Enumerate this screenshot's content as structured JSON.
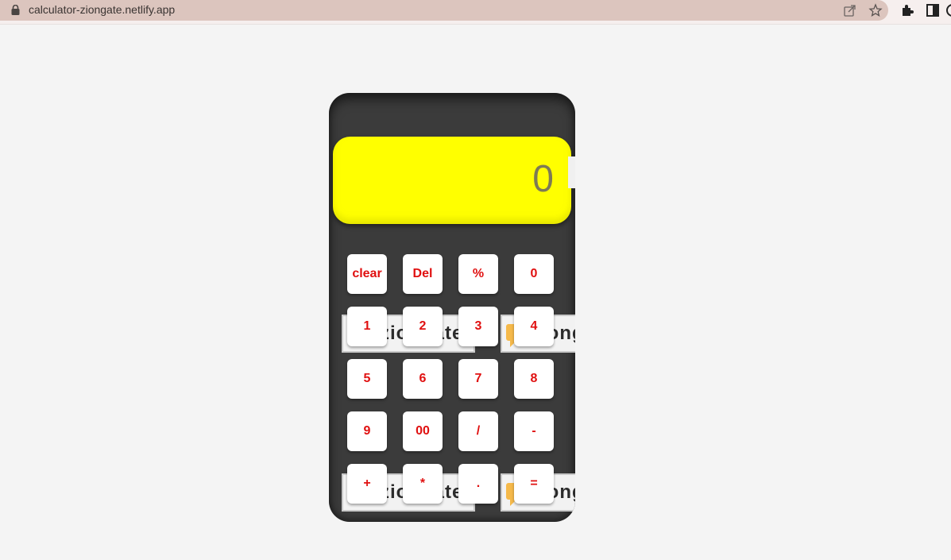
{
  "browser": {
    "url": "calculator-ziongate.netlify.app"
  },
  "display": {
    "value": "0"
  },
  "banner": {
    "left_text": "ziongate",
    "right_text": "ziongate"
  },
  "keys": {
    "row1": [
      "clear",
      "Del",
      "%",
      "0"
    ],
    "row2": [
      "1",
      "2",
      "3",
      "4"
    ],
    "row3": [
      "5",
      "6",
      "7",
      "8"
    ],
    "row4": [
      "9",
      "00",
      "/",
      "-"
    ],
    "row5": [
      "+",
      "*",
      ".",
      "="
    ]
  },
  "colors": {
    "display_bg": "#ffff00",
    "calculator_bg": "#3b3b3b",
    "key_text": "#e01010",
    "key_bg": "#ffffff"
  }
}
